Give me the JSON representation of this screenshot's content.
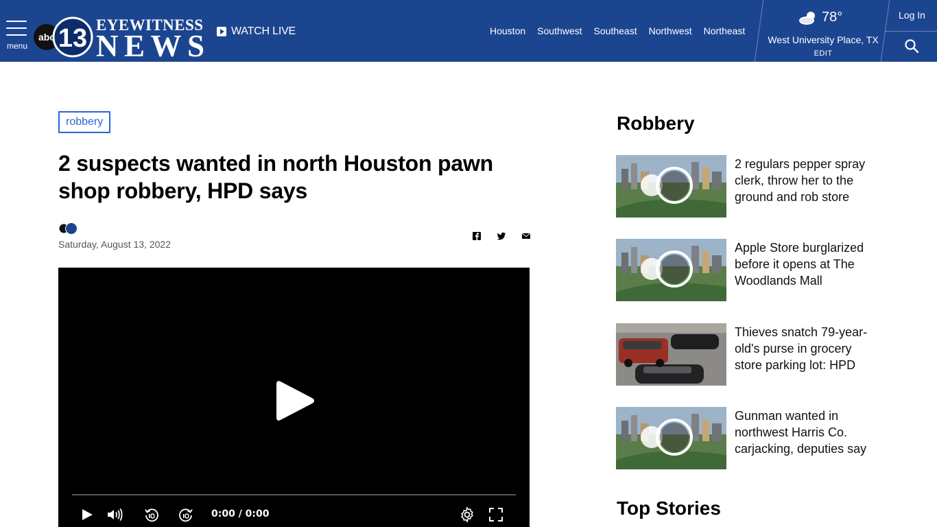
{
  "header": {
    "menu_label": "menu",
    "logo_alt": "abc13 Eyewitness News",
    "logo_badge": "abc",
    "logo_number": "13",
    "logo_word1": "EYEWITNESS",
    "logo_word2": "NEWS",
    "watch_live": "WATCH LIVE",
    "regions": [
      "Houston",
      "Southwest",
      "Southeast",
      "Northwest",
      "Northeast"
    ],
    "weather": {
      "temp": "78°",
      "location": "West University Place, TX",
      "edit": "EDIT"
    },
    "login": "Log In"
  },
  "article": {
    "tag": "robbery",
    "headline": "2 suspects wanted in north Houston pawn shop robbery, HPD says",
    "date": "Saturday, August 13, 2022",
    "share": [
      "facebook-icon",
      "twitter-icon",
      "email-icon"
    ],
    "video": {
      "time": "0:00 / 0:00"
    }
  },
  "sidebar": {
    "section_title": "Robbery",
    "items": [
      {
        "title": "2 regulars pepper spray clerk, throw her to the ground and rob store",
        "thumb": "abc13-skyline"
      },
      {
        "title": "Apple Store burglarized before it opens at The Woodlands Mall",
        "thumb": "abc13-skyline"
      },
      {
        "title": "Thieves snatch 79-year-old's purse in grocery store parking lot: HPD",
        "thumb": "parking-lot"
      },
      {
        "title": "Gunman wanted in northwest Harris Co. carjacking, deputies say",
        "thumb": "abc13-skyline"
      }
    ],
    "next_section_title": "Top Stories"
  },
  "colors": {
    "header_bg": "#1c4590",
    "tag_blue": "#2766d4"
  }
}
